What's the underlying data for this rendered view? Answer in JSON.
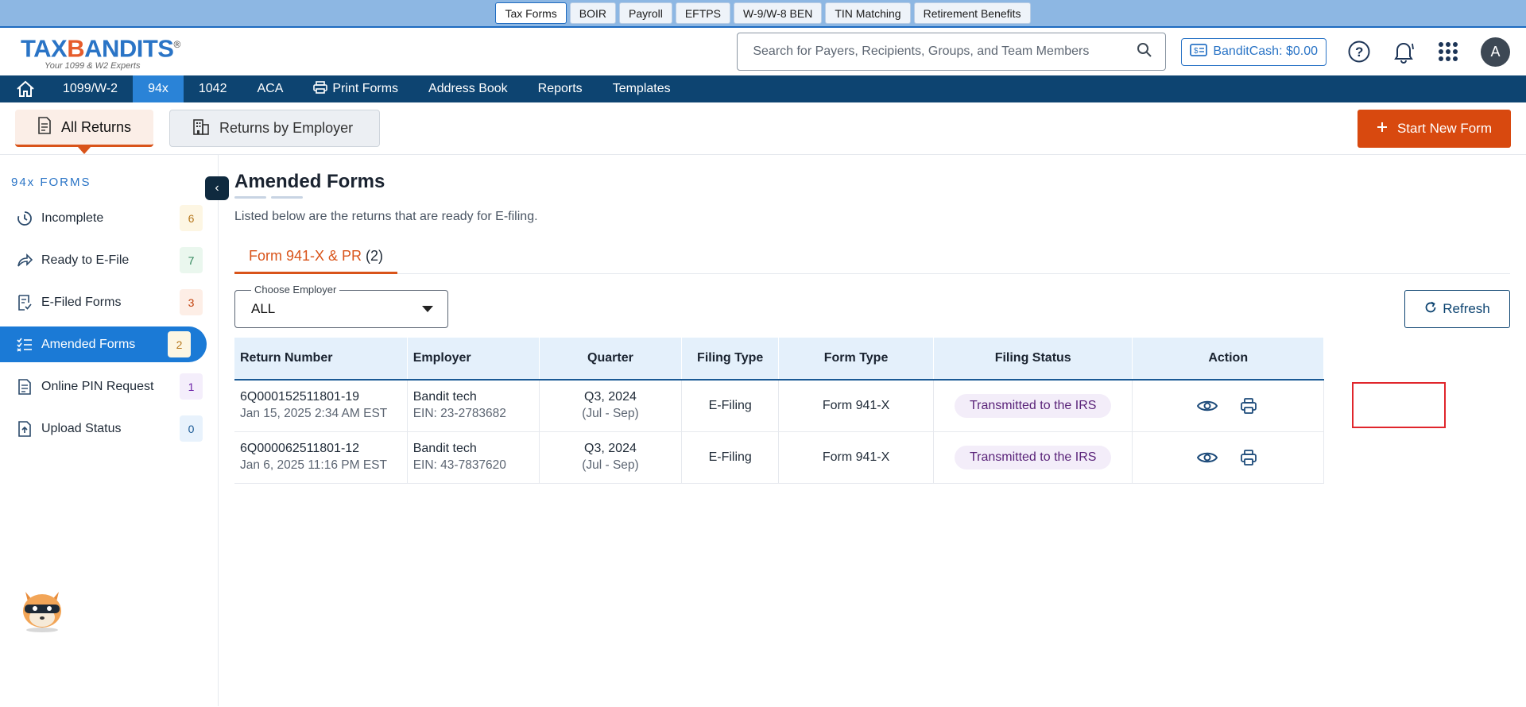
{
  "topstrip": {
    "tabs": [
      "Tax Forms",
      "BOIR",
      "Payroll",
      "EFTPS",
      "W-9/W-8 BEN",
      "TIN Matching",
      "Retirement Benefits"
    ]
  },
  "header": {
    "logo_brand_left": "TAX",
    "logo_brand_right": "ANDITS",
    "logo_registered": "®",
    "logo_tagline": "Your 1099 & W2 Experts",
    "search_placeholder": "Search for Payers, Recipients, Groups, and Team Members",
    "banditcash": "BanditCash: $0.00",
    "avatar_initial": "A"
  },
  "navbar": {
    "items": [
      "1099/W-2",
      "94x",
      "1042",
      "ACA",
      "Print Forms",
      "Address Book",
      "Reports",
      "Templates"
    ],
    "active": "94x"
  },
  "subheader": {
    "tab_all_returns": "All Returns",
    "tab_by_employer": "Returns by Employer",
    "start_new_form": "Start New Form"
  },
  "sidebar": {
    "heading": "94x FORMS",
    "items": [
      {
        "label": "Incomplete",
        "count": "6",
        "count_bg": "#fdf6e3",
        "count_color": "#b7791f"
      },
      {
        "label": "Ready to E-File",
        "count": "7",
        "count_bg": "#eaf7ee",
        "count_color": "#2f855a"
      },
      {
        "label": "E-Filed Forms",
        "count": "3",
        "count_bg": "#fdeee6",
        "count_color": "#c2410c"
      },
      {
        "label": "Amended Forms",
        "count": "2",
        "count_bg": "#fdf6e3",
        "count_color": "#b7791f"
      },
      {
        "label": "Online PIN Request",
        "count": "1",
        "count_bg": "#f4eefb",
        "count_color": "#6b21a8"
      },
      {
        "label": "Upload Status",
        "count": "0",
        "count_bg": "#e8f2fc",
        "count_color": "#1b5a95"
      }
    ]
  },
  "main": {
    "title": "Amended Forms",
    "subtitle": "Listed below are the returns that are ready for E-filing.",
    "form_tab_label": "Form 941-X & PR",
    "form_tab_count": "(2)",
    "choose_employer_label": "Choose Employer",
    "choose_employer_value": "ALL",
    "refresh_label": "Refresh",
    "table": {
      "headers": [
        "Return Number",
        "Employer",
        "Quarter",
        "Filing Type",
        "Form Type",
        "Filing Status",
        "Action"
      ],
      "rows": [
        {
          "return_number": "6Q000152511801-19",
          "date": "Jan 15, 2025 2:34 AM EST",
          "employer": "Bandit tech",
          "ein": "EIN: 23-2783682",
          "quarter": "Q3, 2024",
          "quarter_range": "(Jul - Sep)",
          "filing_type": "E-Filing",
          "form_type": "Form 941-X",
          "filing_status": "Transmitted to the IRS"
        },
        {
          "return_number": "6Q000062511801-12",
          "date": "Jan 6, 2025 11:16 PM EST",
          "employer": "Bandit tech",
          "ein": "EIN: 43-7837620",
          "quarter": "Q3, 2024",
          "quarter_range": "(Jul - Sep)",
          "filing_type": "E-Filing",
          "form_type": "Form 941-X",
          "filing_status": "Transmitted to the IRS"
        }
      ]
    }
  },
  "colors": {
    "brand_blue": "#2a74c6",
    "nav_bg": "#0d4471",
    "nav_active": "#2a83d7",
    "accent_orange": "#d8490f",
    "highlight_red": "#e0262c"
  },
  "icons": [
    "home-icon",
    "search-icon",
    "wallet-icon",
    "help-icon",
    "bell-icon",
    "apps-grid-icon",
    "printer-icon",
    "document-icon",
    "building-icon",
    "plus-icon",
    "clock-icon",
    "share-arrow-icon",
    "checklist-icon",
    "list-edit-icon",
    "pin-document-icon",
    "upload-icon",
    "chevron-left-icon",
    "refresh-icon",
    "eye-icon",
    "mascot-icon"
  ]
}
